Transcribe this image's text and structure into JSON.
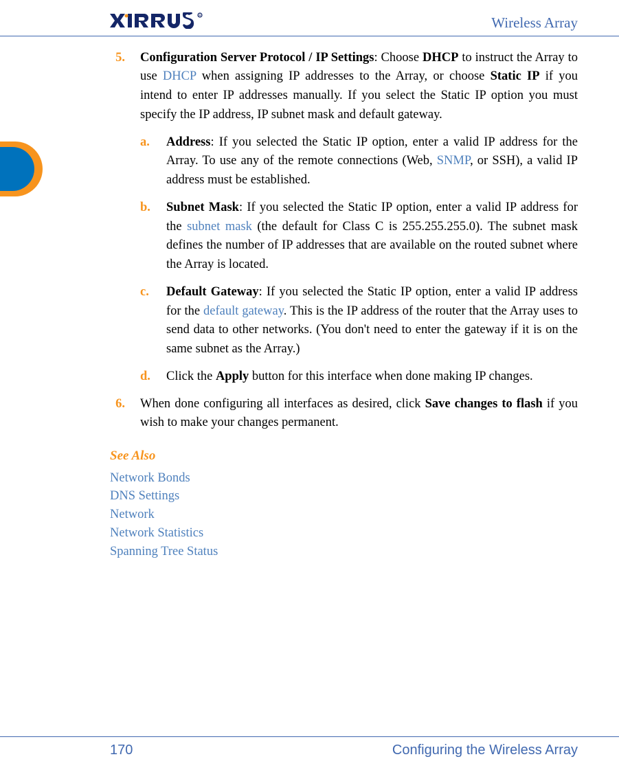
{
  "header": {
    "doc_title": "Wireless Array"
  },
  "item5": {
    "num": "5.",
    "bold_title": "Configuration Server Protocol / IP Settings",
    "t1": ": Choose ",
    "dhcp_bold": "DHCP",
    "t2": " to instruct the Array to use ",
    "dhcp_link": "DHCP",
    "t3": " when assigning IP addresses to the Array, or choose ",
    "static_bold": "Static IP",
    "t4": " if you intend to enter IP addresses manually. If you select the Static IP option you must specify the IP address, IP subnet mask and default gateway."
  },
  "sub_a": {
    "letter": "a.",
    "bold": "Address",
    "t1": ": If you selected the Static IP option, enter a valid IP address for the Array. To use any of the remote connections (Web, ",
    "snmp_link": "SNMP",
    "t2": ", or SSH), a valid IP address must be established."
  },
  "sub_b": {
    "letter": "b.",
    "bold": "Subnet Mask",
    "t1": ": If you selected the Static IP option, enter a valid IP address for the ",
    "subnet_link": "subnet mask",
    "t2": " (the default for Class C is 255.255.255.0). The subnet mask defines the number of IP addresses that are available on the routed subnet where the Array is located."
  },
  "sub_c": {
    "letter": "c.",
    "bold": "Default Gateway",
    "t1": ": If you selected the Static IP option, enter a valid IP address for the ",
    "gateway_link": "default gateway",
    "t2": ". This is the IP address of the router that the Array uses to send data to other networks. (You don't need to enter the gateway if it is on the same subnet as the Array.)"
  },
  "sub_d": {
    "letter": "d.",
    "t1": "Click the ",
    "apply_bold": "Apply",
    "t2": " button for this interface when done making IP changes."
  },
  "item6": {
    "num": "6.",
    "t1": "When done configuring all interfaces as desired, click ",
    "save_bold": "Save changes to flash",
    "t2": " if you wish to make your changes permanent."
  },
  "see_also": {
    "heading": "See Also",
    "links": {
      "l0": "Network Bonds",
      "l1": "DNS Settings",
      "l2": "Network",
      "l3": "Network Statistics",
      "l4": "Spanning Tree Status"
    }
  },
  "footer": {
    "page": "170",
    "section": "Configuring the Wireless Array"
  }
}
